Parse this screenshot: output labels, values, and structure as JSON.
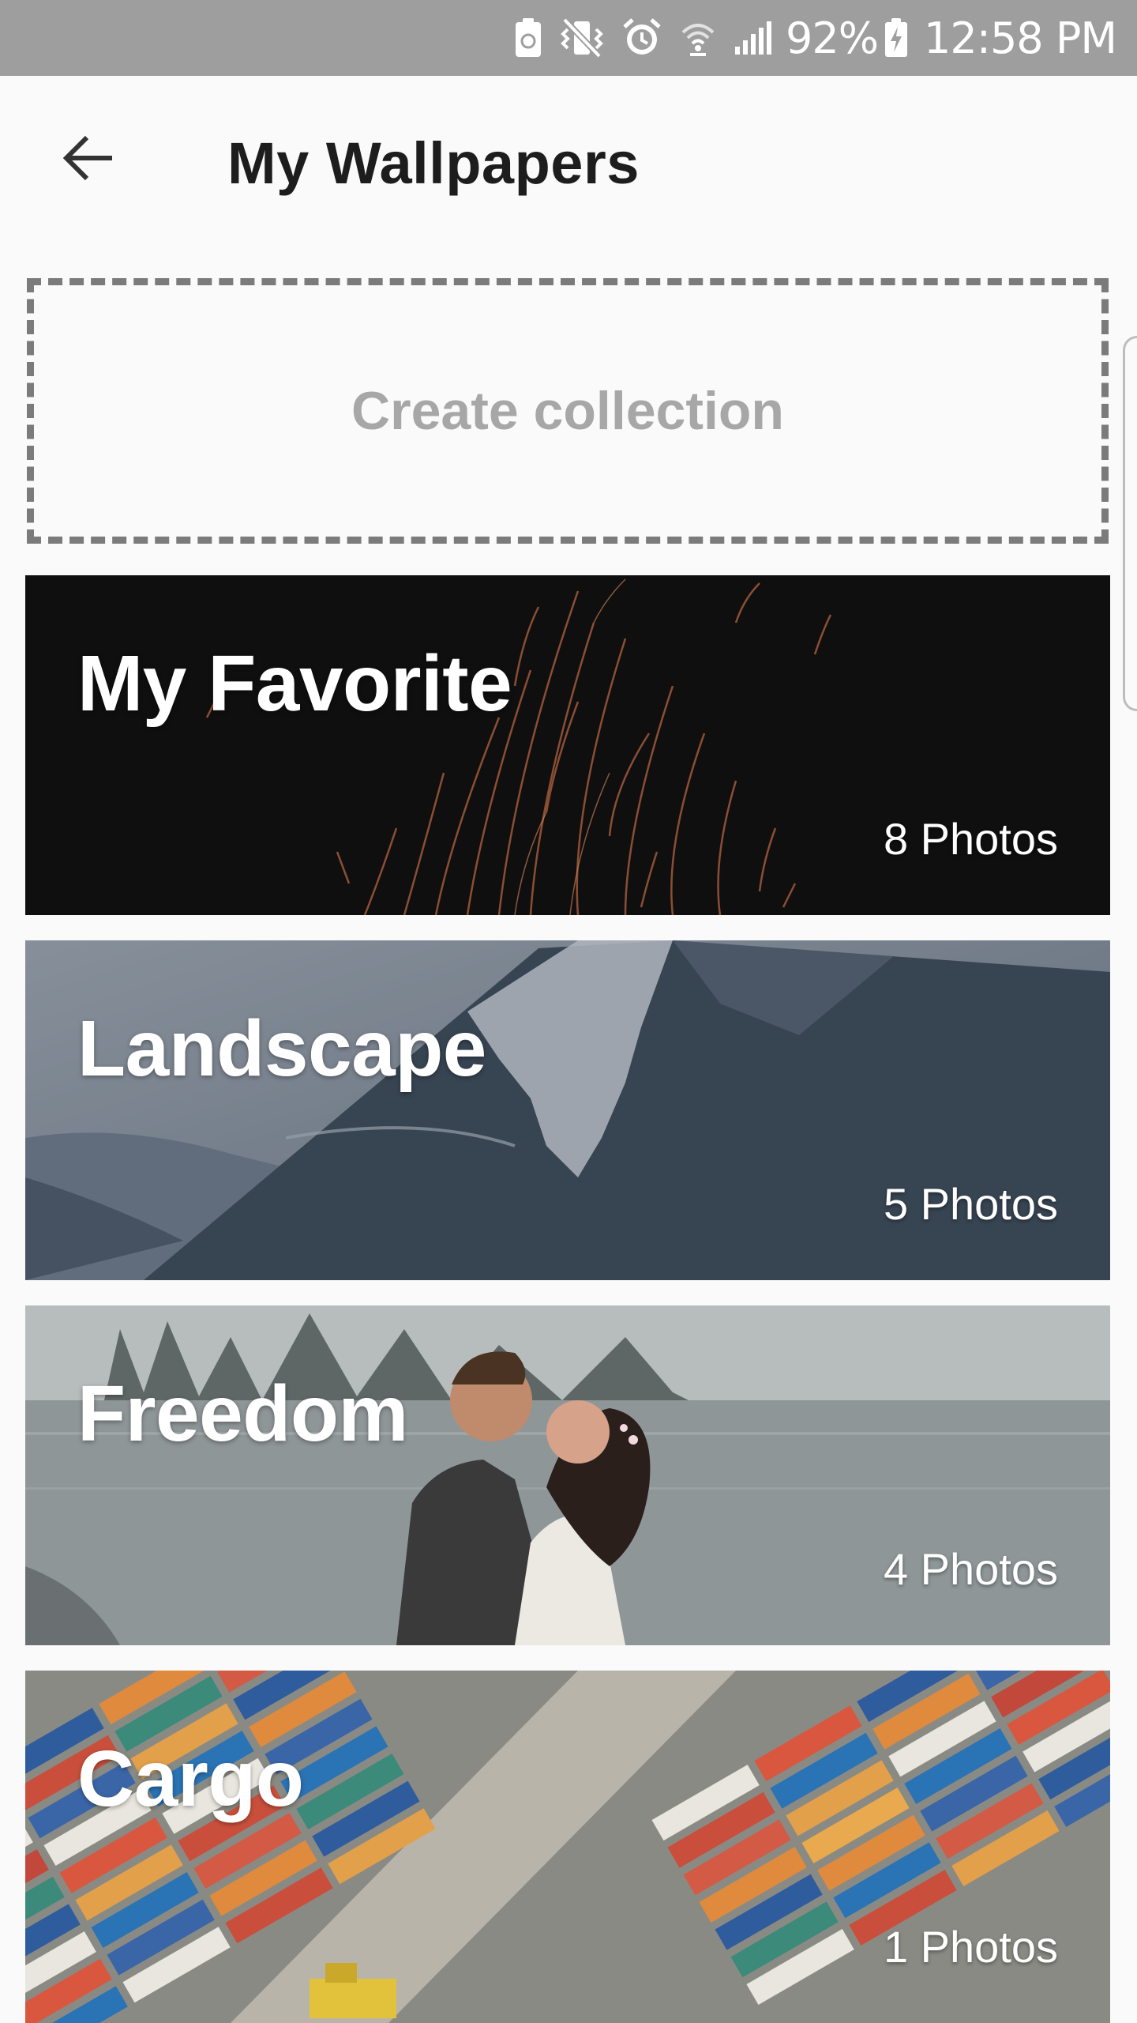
{
  "status_bar": {
    "battery_percent": "92%",
    "time": "12:58 PM",
    "icons": [
      "recycle-battery-icon",
      "vibrate-mute-icon",
      "alarm-icon",
      "wifi-icon",
      "signal-icon",
      "charging-icon"
    ]
  },
  "header": {
    "title": "My Wallpapers",
    "back_icon": "arrow-back-icon"
  },
  "create_collection": {
    "label": "Create collection"
  },
  "collections": [
    {
      "title": "My Favorite",
      "count": "8 Photos",
      "theme": "sparks",
      "color": "#0f0f10"
    },
    {
      "title": "Landscape",
      "count": "5 Photos",
      "theme": "mountain",
      "color": "#55606f"
    },
    {
      "title": "Freedom",
      "count": "4 Photos",
      "theme": "couple-lake",
      "color": "#9aa0a2"
    },
    {
      "title": "Cargo",
      "count": "1 Photos",
      "theme": "containers",
      "color": "#4a6b8a"
    }
  ],
  "colors": {
    "status_bar": "#9e9e9e",
    "background": "#fafafa",
    "dashed_border": "#7b7b7b",
    "create_label": "#a7a7a7"
  }
}
